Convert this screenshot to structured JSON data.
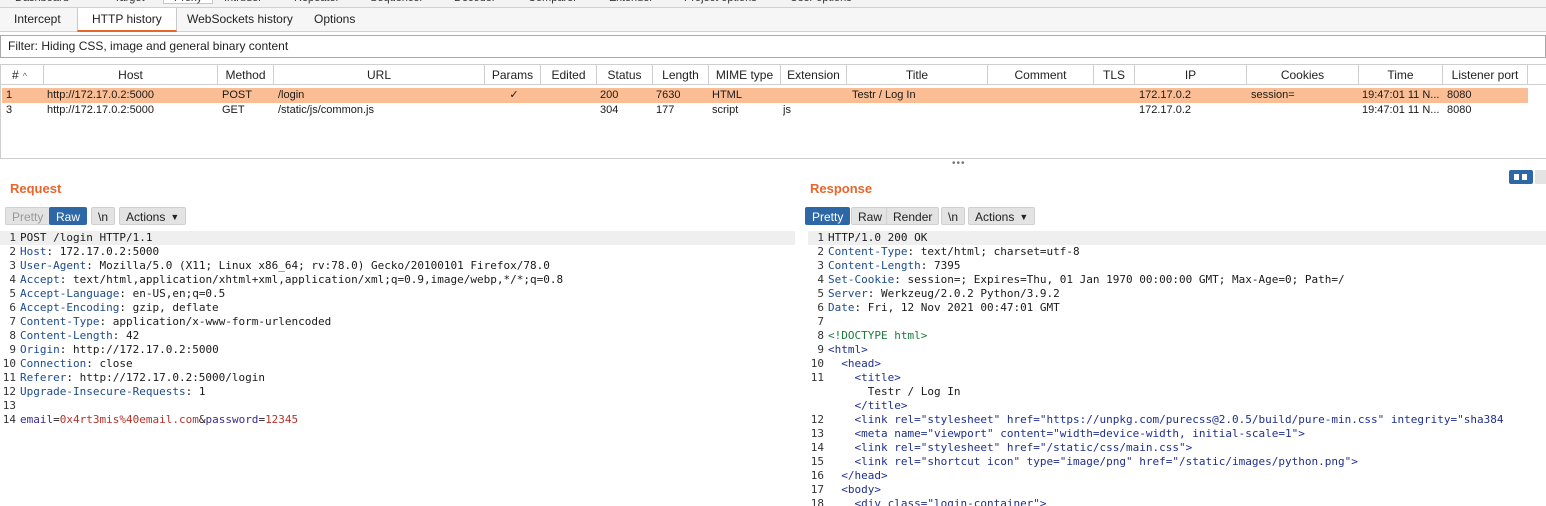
{
  "top_tabs": [
    "Dashboard",
    "Target",
    "Proxy",
    "Intruder",
    "Repeater",
    "Sequencer",
    "Decoder",
    "Comparer",
    "Extender",
    "Project options",
    "User options"
  ],
  "sub_tabs": [
    "Intercept",
    "HTTP history",
    "WebSockets history",
    "Options"
  ],
  "filter": "Filter: Hiding CSS, image and general binary content",
  "columns": [
    "#",
    "Host",
    "Method",
    "URL",
    "Params",
    "Edited",
    "Status",
    "Length",
    "MIME type",
    "Extension",
    "Title",
    "Comment",
    "TLS",
    "IP",
    "Cookies",
    "Time",
    "Listener port"
  ],
  "sort_indicator": "^",
  "rows": [
    {
      "num": "1",
      "host": "http://172.17.0.2:5000",
      "method": "POST",
      "url": "/login",
      "params": "✓",
      "edited": "",
      "status": "200",
      "length": "7630",
      "mime": "HTML",
      "ext": "",
      "title": "Testr / Log In",
      "comment": "",
      "tls": "",
      "ip": "172.17.0.2",
      "cookies": "session=",
      "time": "19:47:01 11 N...",
      "port": "8080",
      "selected": true
    },
    {
      "num": "3",
      "host": "http://172.17.0.2:5000",
      "method": "GET",
      "url": "/static/js/common.js",
      "params": "",
      "edited": "",
      "status": "304",
      "length": "177",
      "mime": "script",
      "ext": "js",
      "title": "",
      "comment": "",
      "tls": "",
      "ip": "172.17.0.2",
      "cookies": "",
      "time": "19:47:01 11 N...",
      "port": "8080",
      "selected": false
    }
  ],
  "splitter": "•••",
  "request": {
    "title": "Request",
    "buttons": {
      "pretty": "Pretty",
      "raw": "Raw",
      "newline": "\\n",
      "actions": "Actions"
    },
    "lines": [
      {
        "n": "1",
        "k": "",
        "v": "POST /login HTTP/1.1"
      },
      {
        "n": "2",
        "k": "Host",
        "v": ": 172.17.0.2:5000"
      },
      {
        "n": "3",
        "k": "User-Agent",
        "v": ": Mozilla/5.0 (X11; Linux x86_64; rv:78.0) Gecko/20100101 Firefox/78.0"
      },
      {
        "n": "4",
        "k": "Accept",
        "v": ": text/html,application/xhtml+xml,application/xml;q=0.9,image/webp,*/*;q=0.8"
      },
      {
        "n": "5",
        "k": "Accept-Language",
        "v": ": en-US,en;q=0.5"
      },
      {
        "n": "6",
        "k": "Accept-Encoding",
        "v": ": gzip, deflate"
      },
      {
        "n": "7",
        "k": "Content-Type",
        "v": ": application/x-www-form-urlencoded"
      },
      {
        "n": "8",
        "k": "Content-Length",
        "v": ": 42"
      },
      {
        "n": "9",
        "k": "Origin",
        "v": ": http://172.17.0.2:5000"
      },
      {
        "n": "10",
        "k": "Connection",
        "v": ": close"
      },
      {
        "n": "11",
        "k": "Referer",
        "v": ": http://172.17.0.2:5000/login"
      },
      {
        "n": "12",
        "k": "Upgrade-Insecure-Requests",
        "v": ": 1"
      },
      {
        "n": "13",
        "k": "",
        "v": ""
      }
    ],
    "body_line": {
      "n": "14",
      "p1": "email",
      "eq1": "=",
      "v1": "0x4rt3mis%40email.com",
      "amp": "&",
      "p2": "password",
      "eq2": "=",
      "v2": "12345"
    }
  },
  "response": {
    "title": "Response",
    "buttons": {
      "pretty": "Pretty",
      "raw": "Raw",
      "render": "Render",
      "newline": "\\n",
      "actions": "Actions"
    },
    "header_lines": [
      {
        "n": "1",
        "k": "",
        "v": "HTTP/1.0 200 OK"
      },
      {
        "n": "2",
        "k": "Content-Type",
        "v": ": text/html; charset=utf-8"
      },
      {
        "n": "3",
        "k": "Content-Length",
        "v": ": 7395"
      },
      {
        "n": "4",
        "k": "Set-Cookie",
        "v": ": session=; Expires=Thu, 01 Jan 1970 00:00:00 GMT; Max-Age=0; Path=/"
      },
      {
        "n": "5",
        "k": "Server",
        "v": ": Werkzeug/2.0.2 Python/3.9.2"
      },
      {
        "n": "6",
        "k": "Date",
        "v": ": Fri, 12 Nov 2021 00:47:01 GMT"
      },
      {
        "n": "7",
        "k": "",
        "v": ""
      }
    ],
    "html_lines": [
      {
        "n": "8",
        "ind": "",
        "t": "<!DOCTYPE html>"
      },
      {
        "n": "9",
        "ind": "",
        "t": "<html>"
      },
      {
        "n": "10",
        "ind": "  ",
        "t": "<head>"
      },
      {
        "n": "11",
        "ind": "    ",
        "t": "<title>"
      },
      {
        "n": "",
        "ind": "      ",
        "t": "Testr / Log In"
      },
      {
        "n": "",
        "ind": "    ",
        "t": "</title>"
      },
      {
        "n": "12",
        "ind": "    ",
        "t": "<link rel=\"stylesheet\" href=\"https://unpkg.com/purecss@2.0.5/build/pure-min.css\" integrity=\"sha384"
      },
      {
        "n": "13",
        "ind": "    ",
        "t": "<meta name=\"viewport\" content=\"width=device-width, initial-scale=1\">"
      },
      {
        "n": "14",
        "ind": "    ",
        "t": "<link rel=\"stylesheet\" href=\"/static/css/main.css\">"
      },
      {
        "n": "15",
        "ind": "    ",
        "t": "<link rel=\"shortcut icon\" type=\"image/png\" href=\"/static/images/python.png\">"
      },
      {
        "n": "16",
        "ind": "  ",
        "t": "</head>"
      },
      {
        "n": "17",
        "ind": "  ",
        "t": "<body>"
      },
      {
        "n": "18",
        "ind": "    ",
        "t": "<div class=\"login-container\">"
      }
    ]
  }
}
